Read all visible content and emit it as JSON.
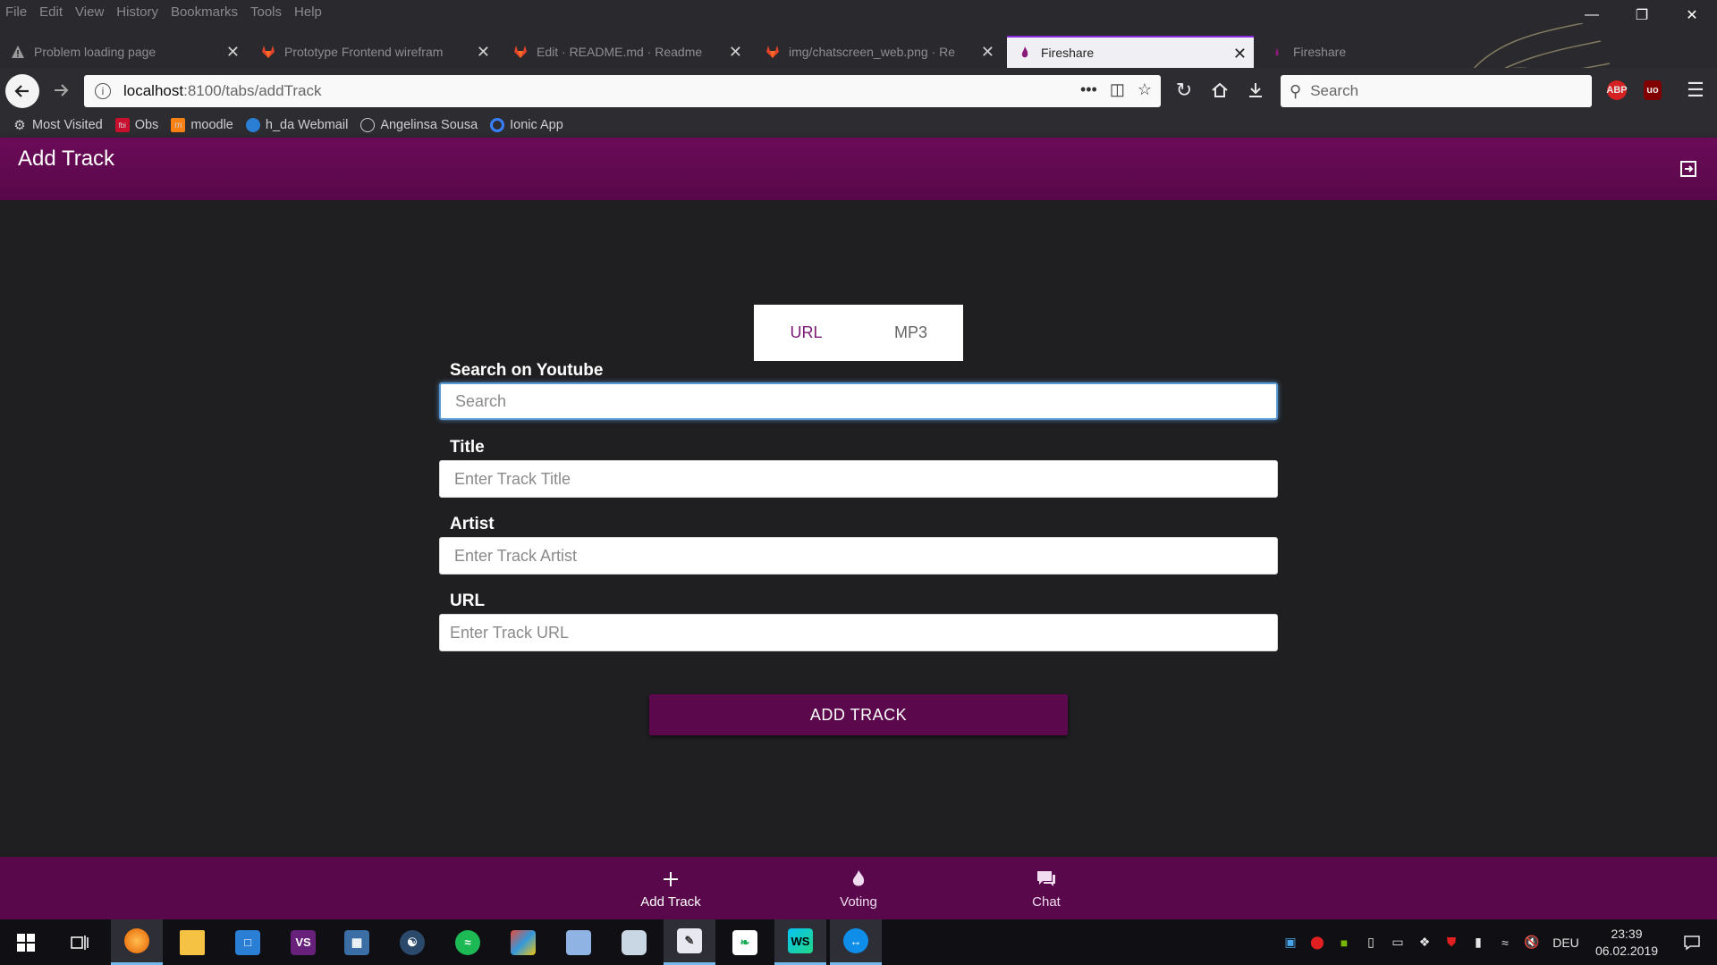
{
  "menubar": {
    "items": [
      "File",
      "Edit",
      "View",
      "History",
      "Bookmarks",
      "Tools",
      "Help"
    ]
  },
  "tabs": [
    {
      "label": "Problem loading page",
      "icon": "warning-icon"
    },
    {
      "label": "Prototype Frontend wirefram",
      "icon": "gitlab-icon"
    },
    {
      "label": "Edit · README.md · Readme",
      "icon": "gitlab-icon"
    },
    {
      "label": "img/chatscreen_web.png · Re",
      "icon": "gitlab-icon"
    },
    {
      "label": "Fireshare",
      "icon": "flame-icon"
    },
    {
      "label": "Fireshare",
      "icon": "flame-icon"
    }
  ],
  "navbar": {
    "url_host": "localhost",
    "url_path": ":8100/tabs/addTrack",
    "search_placeholder": "Search"
  },
  "bookmarks": [
    {
      "label": "Most Visited",
      "icon": "gear-icon"
    },
    {
      "label": "Obs",
      "icon": "obs-icon"
    },
    {
      "label": "moodle",
      "icon": "moodle-icon"
    },
    {
      "label": "h_da Webmail",
      "icon": "mail-icon"
    },
    {
      "label": "Angelinsa Sousa",
      "icon": "globe-icon"
    },
    {
      "label": "Ionic App",
      "icon": "ionic-icon"
    }
  ],
  "app": {
    "title": "Add Track",
    "segment": {
      "options": [
        "URL",
        "MP3"
      ],
      "selected": "URL"
    },
    "fields": {
      "search": {
        "label": "Search on Youtube",
        "placeholder": "Search"
      },
      "title": {
        "label": "Title",
        "placeholder": "Enter Track Title"
      },
      "artist": {
        "label": "Artist",
        "placeholder": "Enter Track Artist"
      },
      "url": {
        "label": "URL",
        "placeholder": "Enter Track URL"
      }
    },
    "add_button": "ADD TRACK",
    "tabbar": [
      {
        "label": "Add Track",
        "icon": "plus-icon"
      },
      {
        "label": "Voting",
        "icon": "flame-icon"
      },
      {
        "label": "Chat",
        "icon": "chat-icon"
      }
    ]
  },
  "taskbar": {
    "language": "DEU",
    "time": "23:39",
    "date": "06.02.2019"
  },
  "colors": {
    "app_primary": "#59084b",
    "segment_active": "#7b1a75",
    "focus_ring": "#5b9bd5"
  }
}
